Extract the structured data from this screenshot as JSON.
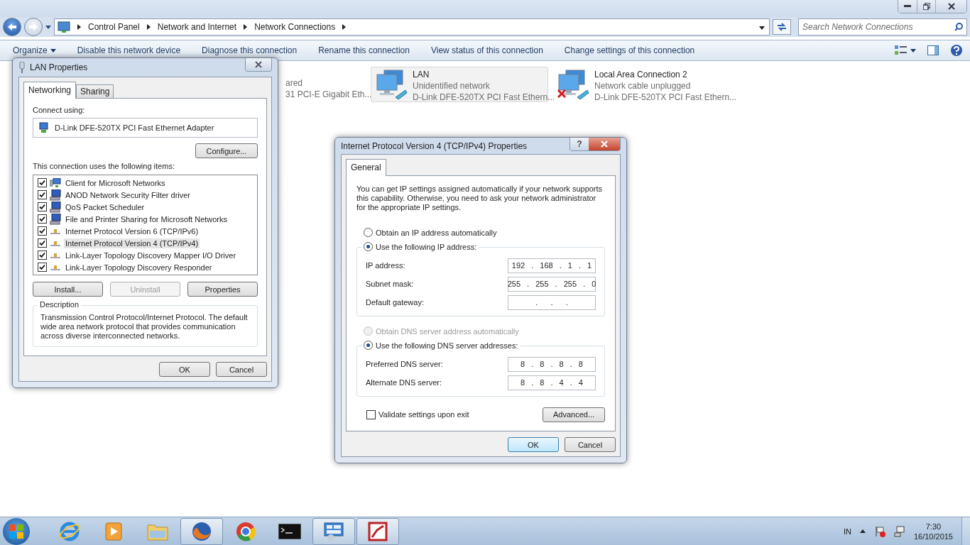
{
  "explorer": {
    "breadcrumb": [
      "Control Panel",
      "Network and Internet",
      "Network Connections"
    ],
    "search": {
      "placeholder": "Search Network Connections"
    },
    "toolbar": [
      {
        "label": "Organize",
        "kind": "menu"
      },
      {
        "label": "Disable this network device",
        "kind": "plain"
      },
      {
        "label": "Diagnose this connection",
        "kind": "plain"
      },
      {
        "label": "Rename this connection",
        "kind": "plain"
      },
      {
        "label": "View status of this connection",
        "kind": "plain"
      },
      {
        "label": "Change settings of this connection",
        "kind": "plain"
      }
    ],
    "connections": [
      {
        "kind": "covered",
        "status": "ared",
        "device": "31 PCI-E Gigabit Eth...",
        "selected": false
      },
      {
        "kind": "ok",
        "name": "LAN",
        "status": "Unidentified network",
        "device": "D-Link DFE-520TX PCI Fast Ethern...",
        "selected": true
      },
      {
        "kind": "unplugged",
        "name": "Local Area Connection 2",
        "status": "Network cable unplugged",
        "device": "D-Link DFE-520TX PCI Fast Ethern...",
        "selected": false
      }
    ]
  },
  "lan_dialog": {
    "title": "LAN Properties",
    "tabs": [
      {
        "label": "Networking",
        "selected": true
      },
      {
        "label": "Sharing",
        "selected": false
      }
    ],
    "connect_using": "Connect using:",
    "adapter": "D-Link DFE-520TX PCI Fast Ethernet Adapter",
    "configure": "Configure...",
    "items_label": "This connection uses the following items:",
    "items": [
      {
        "label": "Client for Microsoft Networks",
        "kind": "client",
        "checked": true,
        "selected": false
      },
      {
        "label": "ANOD Network Security Filter driver",
        "kind": "service",
        "checked": true,
        "selected": false
      },
      {
        "label": "QoS Packet Scheduler",
        "kind": "service",
        "checked": true,
        "selected": false
      },
      {
        "label": "File and Printer Sharing for Microsoft Networks",
        "kind": "service",
        "checked": true,
        "selected": false
      },
      {
        "label": "Internet Protocol Version 6 (TCP/IPv6)",
        "kind": "protocol",
        "checked": true,
        "selected": false
      },
      {
        "label": "Internet Protocol Version 4 (TCP/IPv4)",
        "kind": "protocol",
        "checked": true,
        "selected": true
      },
      {
        "label": "Link-Layer Topology Discovery Mapper I/O Driver",
        "kind": "protocol",
        "checked": true,
        "selected": false
      },
      {
        "label": "Link-Layer Topology Discovery Responder",
        "kind": "protocol",
        "checked": true,
        "selected": false
      }
    ],
    "item_buttons": [
      {
        "label": "Install...",
        "disabled": false
      },
      {
        "label": "Uninstall",
        "disabled": true
      },
      {
        "label": "Properties",
        "disabled": false
      }
    ],
    "description": {
      "label": "Description",
      "text": "Transmission Control Protocol/Internet Protocol. The default wide area network protocol that provides communication across diverse interconnected networks."
    },
    "buttons": [
      "OK",
      "Cancel"
    ]
  },
  "ipv4_dialog": {
    "title": "Internet Protocol Version 4 (TCP/IPv4) Properties",
    "help": "?",
    "tabs": [
      {
        "label": "General",
        "selected": true
      }
    ],
    "intro": "You can get IP settings assigned automatically if your network supports this capability. Otherwise, you need to ask your network administrator for the appropriate IP settings.",
    "ip_options": [
      {
        "label": "Obtain an IP address automatically",
        "selected": false,
        "disabled": false
      },
      {
        "label": "Use the following IP address:",
        "selected": true,
        "disabled": false
      }
    ],
    "ip_fields": [
      {
        "label": "IP address:",
        "value": "192 . 168 . 1 . 1"
      },
      {
        "label": "Subnet mask:",
        "value": "255 . 255 . 255 . 0"
      },
      {
        "label": "Default gateway:",
        "value": ".  .  ."
      }
    ],
    "dns_options": [
      {
        "label": "Obtain DNS server address automatically",
        "selected": false,
        "disabled": true
      },
      {
        "label": "Use the following DNS server addresses:",
        "selected": true,
        "disabled": false
      }
    ],
    "dns_fields": [
      {
        "label": "Preferred DNS server:",
        "value": "8 . 8 . 8 . 8"
      },
      {
        "label": "Alternate DNS server:",
        "value": "8 . 8 . 4 . 4"
      }
    ],
    "validate": {
      "label": "Validate settings upon exit",
      "checked": false
    },
    "advanced": "Advanced...",
    "buttons": [
      {
        "label": "OK",
        "default": true
      },
      {
        "label": "Cancel",
        "default": false
      }
    ]
  },
  "taskbar": {
    "apps": [
      {
        "kind": "globe",
        "active": false
      },
      {
        "kind": "media",
        "active": false
      },
      {
        "kind": "folder",
        "active": false
      },
      {
        "kind": "fox",
        "active": true
      },
      {
        "kind": "chrome",
        "active": false
      },
      {
        "kind": "terminal",
        "active": false
      },
      {
        "kind": "panel",
        "active": true
      },
      {
        "kind": "doc",
        "active": true
      }
    ],
    "language": "IN",
    "time": "7:30",
    "date": "16/10/2015"
  }
}
